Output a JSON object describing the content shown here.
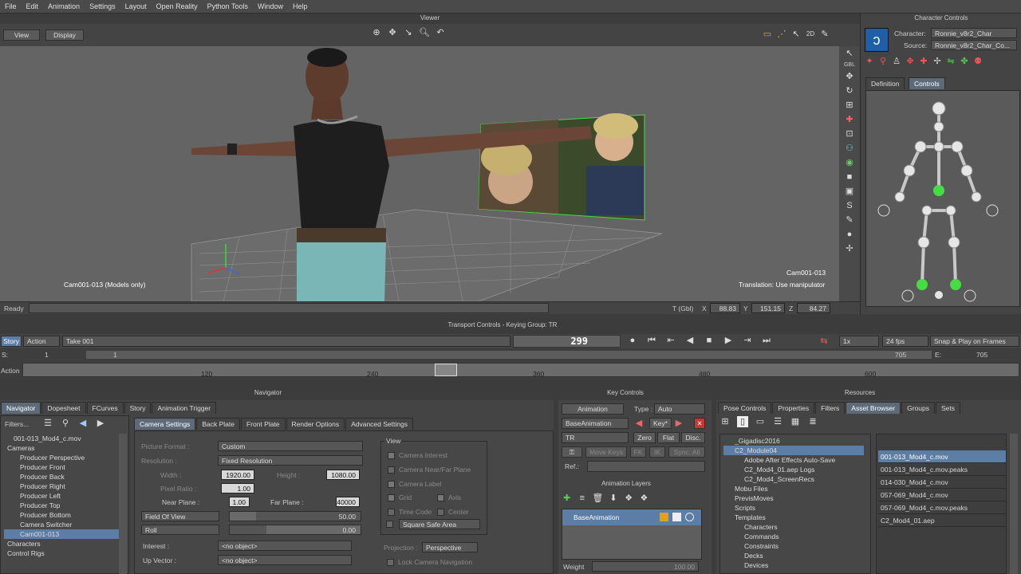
{
  "menu": [
    "File",
    "Edit",
    "Animation",
    "Settings",
    "Layout",
    "Open Reality",
    "Python Tools",
    "Window",
    "Help"
  ],
  "viewer": {
    "title": "Viewer",
    "view_btn": "View",
    "display_btn": "Display",
    "cam_left": "Cam001-013 (Models only)",
    "cam_right": "Cam001-013",
    "translation": "Translation: Use manipulator",
    "status": "Ready",
    "coord_label": "T (Gbl)",
    "x_label": "X",
    "x": "88.83",
    "y_label": "Y",
    "y": "151.15",
    "z_label": "Z",
    "z": "84.27"
  },
  "char_controls": {
    "title": "Character Controls",
    "character_label": "Character:",
    "character": "Ronnie_v8r2_Char",
    "source_label": "Source:",
    "source": "Ronnie_v8r2_Char_Co...",
    "tab_definition": "Definition",
    "tab_controls": "Controls",
    "gbl": "GBL"
  },
  "transport": {
    "title": "Transport Controls - Keying Group: TR",
    "story": "Story",
    "action": "Action",
    "take": "Take 001",
    "frame": "299",
    "speed": "1x",
    "fps": "24 fps",
    "snap": "Snap & Play on Frames",
    "s_label": "S:",
    "s_value": "1",
    "start": "1",
    "end_mark": "705",
    "e_label": "E:",
    "e_value": "705",
    "action_row": "Action",
    "ticks": [
      "120",
      "240",
      "360",
      "480",
      "600"
    ]
  },
  "navigator": {
    "title": "Navigator",
    "tabs": [
      "Navigator",
      "Dopesheet",
      "FCurves",
      "Story",
      "Animation Trigger"
    ],
    "filters": "Filters...",
    "tree": [
      "001-013_Mod4_c.mov",
      "Cameras",
      "Producer Perspective",
      "Producer Front",
      "Producer Back",
      "Producer Right",
      "Producer Left",
      "Producer Top",
      "Producer Bottom",
      "Camera Switcher",
      "Cam001-013",
      "Characters",
      "Control Rigs"
    ],
    "sub_tabs": [
      "Camera Settings",
      "Back Plate",
      "Front Plate",
      "Render Options",
      "Advanced Settings"
    ],
    "picture_format_label": "Picture Format :",
    "picture_format": "Custom",
    "resolution_label": "Resolution :",
    "resolution": "Fixed Resolution",
    "width_label": "Width :",
    "width": "1920.00",
    "height_label": "Height :",
    "height": "1080.00",
    "pixel_ratio_label": "Pixel Ratio :",
    "pixel_ratio": "1.00",
    "near_label": "Near Plane :",
    "near": "1.00",
    "far_label": "Far Plane :",
    "far": "40000",
    "fov_label": "Field Of View",
    "fov": "50.00",
    "roll_label": "Roll",
    "roll": "0.00",
    "interest_label": "Interest :",
    "interest": "<no object>",
    "upvector_label": "Up Vector :",
    "upvector": "<no object>",
    "view_group": "View",
    "camera_interest": "Camera Interest",
    "camera_nearfar": "Camera Near/Far Plane",
    "camera_label": "Camera Label",
    "grid": "Grid",
    "axis": "Axis",
    "time_code": "Time Code",
    "center": "Center",
    "safe_area": "Square Safe Area",
    "projection_label": "Projection :",
    "projection": "Perspective",
    "lock_nav": "Lock Camera Navigation"
  },
  "key_controls": {
    "title": "Key Controls",
    "animation": "Animation",
    "type_label": "Type :",
    "type": "Auto",
    "base_anim": "BaseAnimation",
    "key": "Key*",
    "tr": "TR",
    "zero": "Zero",
    "flat": "Flat",
    "disc": "Disc.",
    "move_keys": "Move Keys",
    "fk": "FK",
    "ik": "IK",
    "sync": "Sync. All",
    "ref": "Ref.:",
    "layers_title": "Animation Layers",
    "layer_name": "BaseAnimation",
    "weight_label": "Weight",
    "weight": "100.00"
  },
  "resources": {
    "title": "Resources",
    "tabs": [
      "Pose Controls",
      "Properties",
      "Filters",
      "Asset Browser",
      "Groups",
      "Sets"
    ],
    "tree": [
      "_Gigadisc2016",
      "C2_Module04",
      "Adobe After Effects Auto-Save",
      "C2_Mod4_01.aep Logs",
      "C2_Mod4_ScreenRecs",
      "Mobu Files",
      "PrevisMoves",
      "Scripts",
      "Templates",
      "Characters",
      "Commands",
      "Constraints",
      "Decks",
      "Devices"
    ],
    "files": [
      "001-013_Mod4_c.mov",
      "001-013_Mod4_c.mov.peaks",
      "014-030_Mod4_c.mov",
      "057-069_Mod4_c.mov",
      "057-069_Mod4_c.mov.peaks",
      "C2_Mod4_01.aep"
    ]
  },
  "colors": {
    "accent": "#5b7da6",
    "viewport": "#646464",
    "selected_green": "#55ee55"
  }
}
